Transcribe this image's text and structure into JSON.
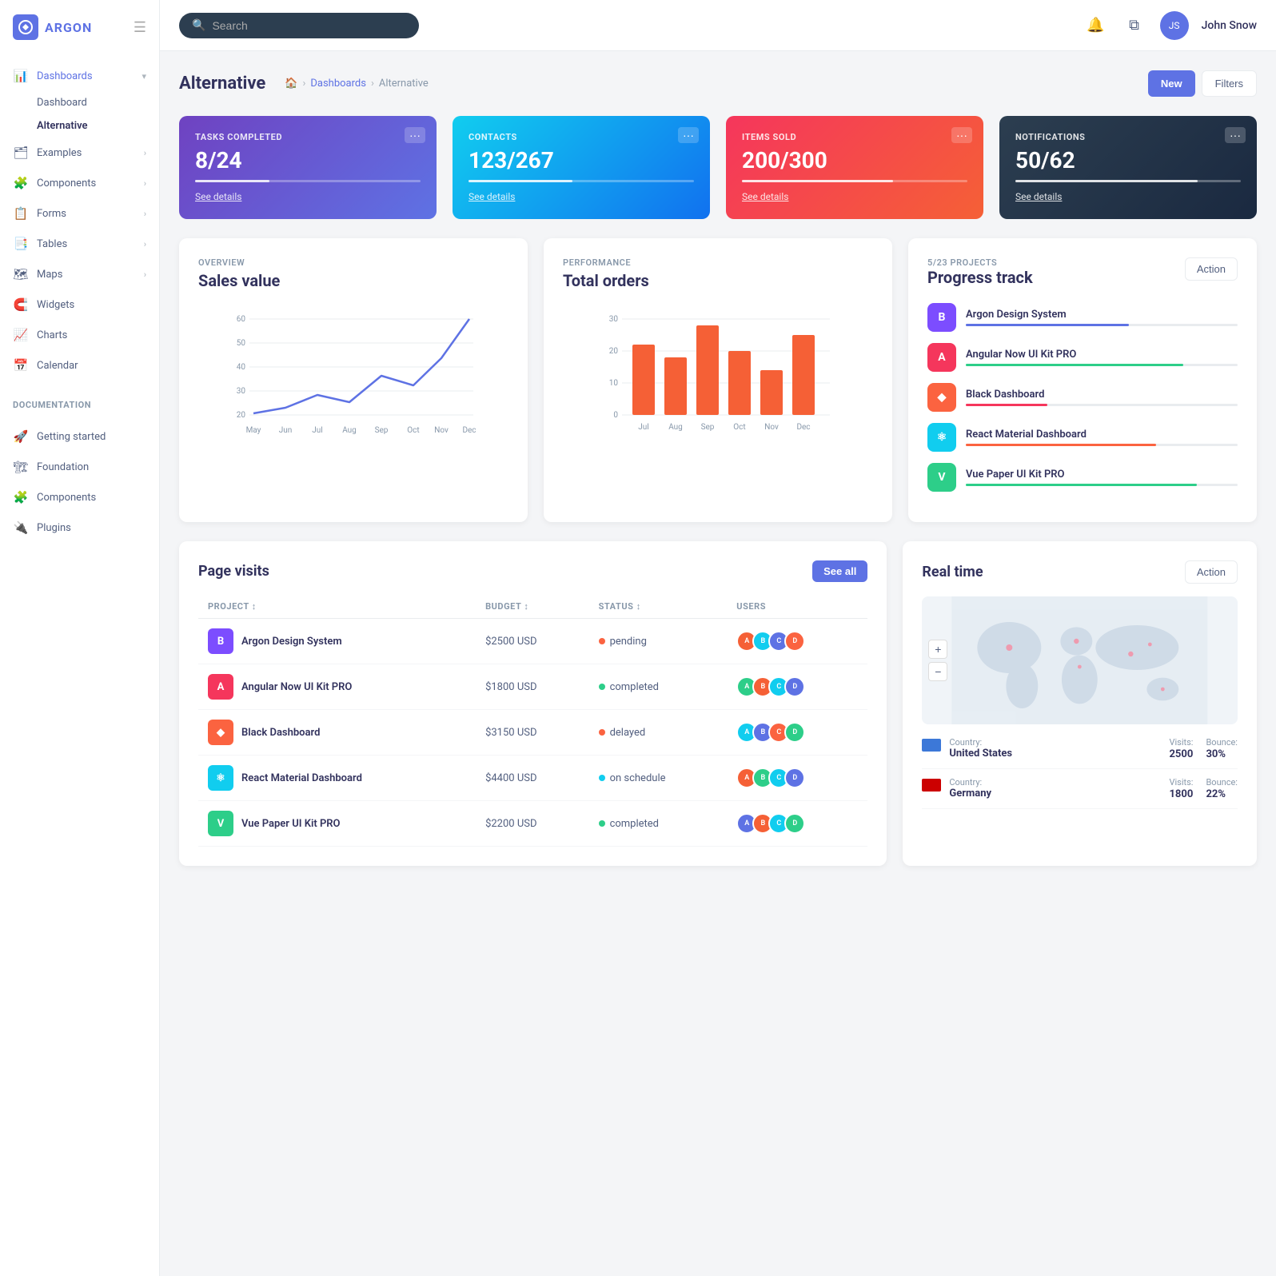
{
  "app": {
    "name": "argon",
    "logo_text": "ARGON"
  },
  "sidebar": {
    "sections": [
      {
        "items": [
          {
            "id": "dashboards",
            "label": "Dashboards",
            "icon": "📊",
            "hasArrow": true,
            "active": true,
            "subitems": [
              {
                "label": "Dashboard",
                "active": false
              },
              {
                "label": "Alternative",
                "active": true
              }
            ]
          },
          {
            "id": "examples",
            "label": "Examples",
            "icon": "🗂",
            "hasArrow": true
          },
          {
            "id": "components",
            "label": "Components",
            "icon": "🧩",
            "hasArrow": true
          },
          {
            "id": "forms",
            "label": "Forms",
            "icon": "📋",
            "hasArrow": true
          },
          {
            "id": "tables",
            "label": "Tables",
            "icon": "📑",
            "hasArrow": true
          },
          {
            "id": "maps",
            "label": "Maps",
            "icon": "🗺",
            "hasArrow": true
          },
          {
            "id": "widgets",
            "label": "Widgets",
            "icon": "🧲"
          },
          {
            "id": "charts",
            "label": "Charts",
            "icon": "📈"
          },
          {
            "id": "calendar",
            "label": "Calendar",
            "icon": "📅"
          }
        ]
      },
      {
        "label": "DOCUMENTATION",
        "items": [
          {
            "id": "getting-started",
            "label": "Getting started",
            "icon": "🚀"
          },
          {
            "id": "foundation",
            "label": "Foundation",
            "icon": "🏗"
          },
          {
            "id": "doc-components",
            "label": "Components",
            "icon": "🧩"
          },
          {
            "id": "plugins",
            "label": "Plugins",
            "icon": "🔌"
          }
        ]
      }
    ]
  },
  "topbar": {
    "search_placeholder": "Search",
    "notification_count": "",
    "user_name": "John Snow"
  },
  "page": {
    "title": "Alternative",
    "breadcrumb_home": "🏠",
    "breadcrumb_dashboards": "Dashboards",
    "breadcrumb_current": "Alternative",
    "btn_new": "New",
    "btn_filters": "Filters"
  },
  "stats": [
    {
      "label": "TASKS COMPLETED",
      "value": "8/24",
      "progress": 33,
      "link": "See details",
      "color": "purple"
    },
    {
      "label": "CONTACTS",
      "value": "123/267",
      "progress": 46,
      "link": "See details",
      "color": "blue"
    },
    {
      "label": "ITEMS SOLD",
      "value": "200/300",
      "progress": 67,
      "link": "See details",
      "color": "red"
    },
    {
      "label": "NOTIFICATIONS",
      "value": "50/62",
      "progress": 81,
      "link": "See details",
      "color": "dark"
    }
  ],
  "sales_chart": {
    "meta": "OVERVIEW",
    "title": "Sales value",
    "labels": [
      "May",
      "Jun",
      "Jul",
      "Aug",
      "Sep",
      "Oct",
      "Nov",
      "Dec"
    ],
    "values": [
      20,
      22,
      28,
      24,
      35,
      30,
      42,
      58
    ]
  },
  "orders_chart": {
    "meta": "PERFORMANCE",
    "title": "Total orders",
    "labels": [
      "Jul",
      "Aug",
      "Sep",
      "Oct",
      "Nov",
      "Dec"
    ],
    "values": [
      22,
      18,
      28,
      20,
      14,
      25
    ]
  },
  "progress_track": {
    "meta": "5/23 PROJECTS",
    "title": "Progress track",
    "btn": "Action",
    "items": [
      {
        "name": "Argon Design System",
        "icon": "B",
        "icon_bg": "#7c4dff",
        "icon_color": "#fff",
        "progress": 60,
        "bar_color": "#5e72e4"
      },
      {
        "name": "Angular Now UI Kit PRO",
        "icon": "A",
        "icon_bg": "#f5365c",
        "icon_color": "#fff",
        "progress": 80,
        "bar_color": "#2dce89"
      },
      {
        "name": "Black Dashboard",
        "icon": "◆",
        "icon_bg": "#fb6340",
        "icon_color": "#fff",
        "progress": 30,
        "bar_color": "#f5365c"
      },
      {
        "name": "React Material Dashboard",
        "icon": "⚛",
        "icon_bg": "#11cdef",
        "icon_color": "#fff",
        "progress": 70,
        "bar_color": "#fb6340"
      },
      {
        "name": "Vue Paper UI Kit PRO",
        "icon": "V",
        "icon_bg": "#2dce89",
        "icon_color": "#fff",
        "progress": 85,
        "bar_color": "#2dce89"
      }
    ]
  },
  "page_visits": {
    "title": "Page visits",
    "btn_see_all": "See all",
    "columns": [
      "PROJECT",
      "BUDGET",
      "STATUS",
      "USERS"
    ],
    "rows": [
      {
        "name": "Argon Design System",
        "icon": "B",
        "icon_bg": "#7c4dff",
        "icon_color": "#fff",
        "budget": "$2500 USD",
        "status": "pending",
        "status_color": "#fb6340",
        "users": [
          "#f56036",
          "#11cdef",
          "#5e72e4",
          "#fb6340"
        ]
      },
      {
        "name": "Angular Now UI Kit PRO",
        "icon": "A",
        "icon_bg": "#f5365c",
        "icon_color": "#fff",
        "budget": "$1800 USD",
        "status": "completed",
        "status_color": "#2dce89",
        "users": [
          "#2dce89",
          "#f56036",
          "#11cdef",
          "#5e72e4"
        ]
      },
      {
        "name": "Black Dashboard",
        "icon": "◆",
        "icon_bg": "#fb6340",
        "icon_color": "#fff",
        "budget": "$3150 USD",
        "status": "delayed",
        "status_color": "#fb6340",
        "users": [
          "#11cdef",
          "#5e72e4",
          "#fb6340",
          "#2dce89"
        ]
      },
      {
        "name": "React Material Dashboard",
        "icon": "⚛",
        "icon_bg": "#11cdef",
        "icon_color": "#fff",
        "budget": "$4400 USD",
        "status": "on schedule",
        "status_color": "#11cdef",
        "users": [
          "#f56036",
          "#2dce89",
          "#11cdef",
          "#5e72e4"
        ]
      },
      {
        "name": "Vue Paper UI Kit PRO",
        "icon": "V",
        "icon_bg": "#2dce89",
        "icon_color": "#fff",
        "budget": "$2200 USD",
        "status": "completed",
        "status_color": "#2dce89",
        "users": [
          "#5e72e4",
          "#f56036",
          "#11cdef",
          "#2dce89"
        ]
      }
    ]
  },
  "realtime": {
    "title": "Real time",
    "btn": "Action",
    "countries": [
      {
        "flag_color": "#3c78d8",
        "country_label": "Country:",
        "country": "United States",
        "visits_label": "Visits:",
        "visits": "2500",
        "bounce_label": "Bounce:",
        "bounce": "30%"
      },
      {
        "flag_color": "#cc0000",
        "country_label": "Country:",
        "country": "Germany",
        "visits_label": "Visits:",
        "visits": "1800",
        "bounce_label": "Bounce:",
        "bounce": "22%"
      }
    ]
  }
}
